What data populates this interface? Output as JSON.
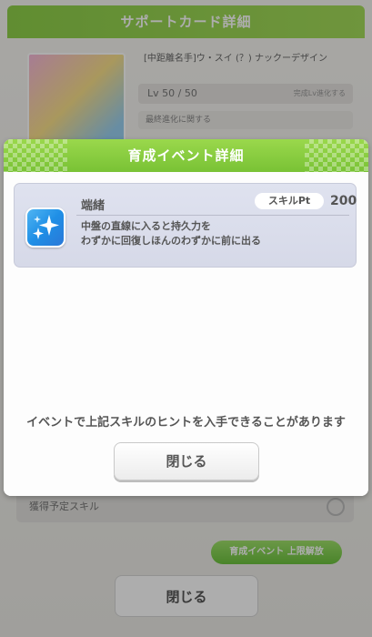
{
  "background": {
    "header_title": "サポートカード詳細",
    "card_name": "[中距離名手]ウ・スイ (？) ナックーデザイン",
    "level_text": "Lv 50 / 50",
    "level_extra": "完成Lv進化する",
    "row_text": "最終進化に関する",
    "lower_row_text": "獲得予定スキル",
    "green_button": "育成イベント 上限解放",
    "close_label": "閉じる"
  },
  "modal": {
    "title": "育成イベント詳細",
    "skill": {
      "icon": "sparkle-skill-icon",
      "name": "端緒",
      "pt_label": "スキルPt",
      "pt_value": "200",
      "description_line1": "中盤の直線に入ると持久力を",
      "description_line2": "わずかに回復しほんのわずかに前に出る"
    },
    "notice": "イベントで上記スキルのヒントを入手できることがあります",
    "close_button": "閉じる"
  },
  "colors": {
    "header_green": "#8ccf45",
    "skill_box": "#dcdfec",
    "skill_icon_blue": "#2a93e8",
    "text_gray": "#555555"
  }
}
